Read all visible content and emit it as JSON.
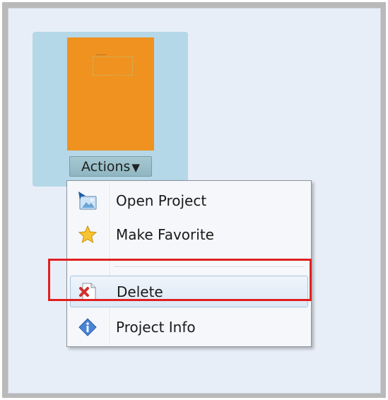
{
  "tile": {
    "actions_label": "Actions"
  },
  "menu": {
    "items": [
      {
        "label": "Open Project",
        "icon": "open-project-icon"
      },
      {
        "label": "Make Favorite",
        "icon": "star-icon"
      },
      {
        "label": "Delete",
        "icon": "delete-document-icon"
      },
      {
        "label": "Project Info",
        "icon": "info-icon"
      }
    ],
    "hovered_item": "Delete"
  },
  "colors": {
    "thumbnail": "#f0921f",
    "tile_selected": "#b5d8e8",
    "highlight_box": "#e02020"
  }
}
